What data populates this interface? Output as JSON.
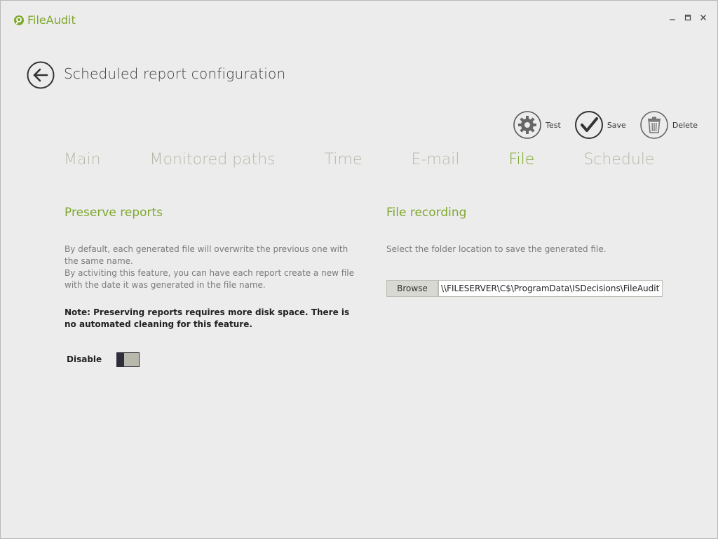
{
  "app": {
    "title": "FileAudit"
  },
  "header": {
    "title": "Scheduled report configuration"
  },
  "actions": {
    "test_label": "Test",
    "save_label": "Save",
    "delete_label": "Delete"
  },
  "tabs": [
    {
      "label": "Main",
      "active": false
    },
    {
      "label": "Monitored paths",
      "active": false
    },
    {
      "label": "Time",
      "active": false
    },
    {
      "label": "E-mail",
      "active": false
    },
    {
      "label": "File",
      "active": true
    },
    {
      "label": "Schedule",
      "active": false
    }
  ],
  "preserve": {
    "title": "Preserve reports",
    "description_line1": "By default, each generated file will overwrite the previous one with the same name.",
    "description_line2": "By activiting this feature, you can have each report create a new file with the date it was generated in the file name.",
    "note": "Note: Preserving reports requires more disk space. There is no automated cleaning for this feature.",
    "toggle_label": "Disable",
    "toggle_enabled": false
  },
  "recording": {
    "title": "File recording",
    "description": "Select the folder location to save the generated file.",
    "browse_label": "Browse",
    "path_value": "\\\\FILESERVER\\C$\\ProgramData\\ISDecisions\\FileAudit\\Reports"
  },
  "colors": {
    "accent": "#7fa82e",
    "tab_inactive": "#b6b9a8",
    "background": "#ececec"
  }
}
